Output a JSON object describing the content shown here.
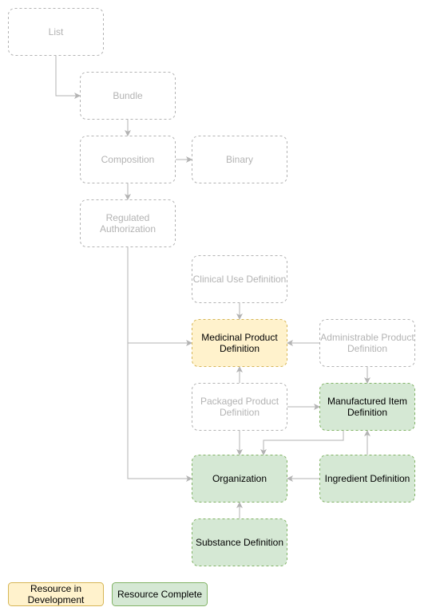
{
  "colors": {
    "inactive_text": "#b3b3b3",
    "inactive_border": "#b3b3b3",
    "development_fill": "#fff2cc",
    "development_border": "#d6b656",
    "complete_fill": "#d5e8d4",
    "complete_border": "#82b366",
    "edge": "#b3b3b3",
    "active_text": "#000000"
  },
  "nodes": [
    {
      "id": "list",
      "label": [
        "List"
      ],
      "status": "inactive"
    },
    {
      "id": "bundle",
      "label": [
        "Bundle"
      ],
      "status": "inactive"
    },
    {
      "id": "composition",
      "label": [
        "Composition"
      ],
      "status": "inactive"
    },
    {
      "id": "binary",
      "label": [
        "Binary"
      ],
      "status": "inactive"
    },
    {
      "id": "regulated-authorization",
      "label": [
        "Regulated",
        "Authorization"
      ],
      "status": "inactive"
    },
    {
      "id": "clinical-use-definition",
      "label": [
        "Clinical Use Definition"
      ],
      "status": "inactive"
    },
    {
      "id": "medicinal-product-definition",
      "label": [
        "Medicinal Product",
        "Definition"
      ],
      "status": "development"
    },
    {
      "id": "administrable-product-definition",
      "label": [
        "Administrable Product",
        "Definition"
      ],
      "status": "inactive"
    },
    {
      "id": "packaged-product-definition",
      "label": [
        "Packaged Product",
        "Definition"
      ],
      "status": "inactive"
    },
    {
      "id": "manufactured-item-definition",
      "label": [
        "Manufactured Item",
        "Definition"
      ],
      "status": "complete"
    },
    {
      "id": "organization",
      "label": [
        "Organization"
      ],
      "status": "complete"
    },
    {
      "id": "ingredient-definition",
      "label": [
        "Ingredient Definition"
      ],
      "status": "complete"
    },
    {
      "id": "substance-definition",
      "label": [
        "Substance Definition"
      ],
      "status": "complete"
    }
  ],
  "edges": [
    {
      "from": "list",
      "to": "bundle"
    },
    {
      "from": "bundle",
      "to": "composition"
    },
    {
      "from": "composition",
      "to": "binary"
    },
    {
      "from": "composition",
      "to": "regulated-authorization"
    },
    {
      "from": "regulated-authorization",
      "to": "medicinal-product-definition"
    },
    {
      "from": "regulated-authorization",
      "to": "organization"
    },
    {
      "from": "clinical-use-definition",
      "to": "medicinal-product-definition"
    },
    {
      "from": "administrable-product-definition",
      "to": "medicinal-product-definition"
    },
    {
      "from": "administrable-product-definition",
      "to": "manufactured-item-definition"
    },
    {
      "from": "packaged-product-definition",
      "to": "medicinal-product-definition"
    },
    {
      "from": "packaged-product-definition",
      "to": "manufactured-item-definition"
    },
    {
      "from": "packaged-product-definition",
      "to": "organization"
    },
    {
      "from": "manufactured-item-definition",
      "to": "organization"
    },
    {
      "from": "ingredient-definition",
      "to": "manufactured-item-definition"
    },
    {
      "from": "ingredient-definition",
      "to": "organization"
    },
    {
      "from": "substance-definition",
      "to": "organization"
    }
  ],
  "legend": [
    {
      "label": [
        "Resource in",
        "Development"
      ],
      "status": "development"
    },
    {
      "label": [
        "Resource Complete"
      ],
      "status": "complete"
    }
  ]
}
